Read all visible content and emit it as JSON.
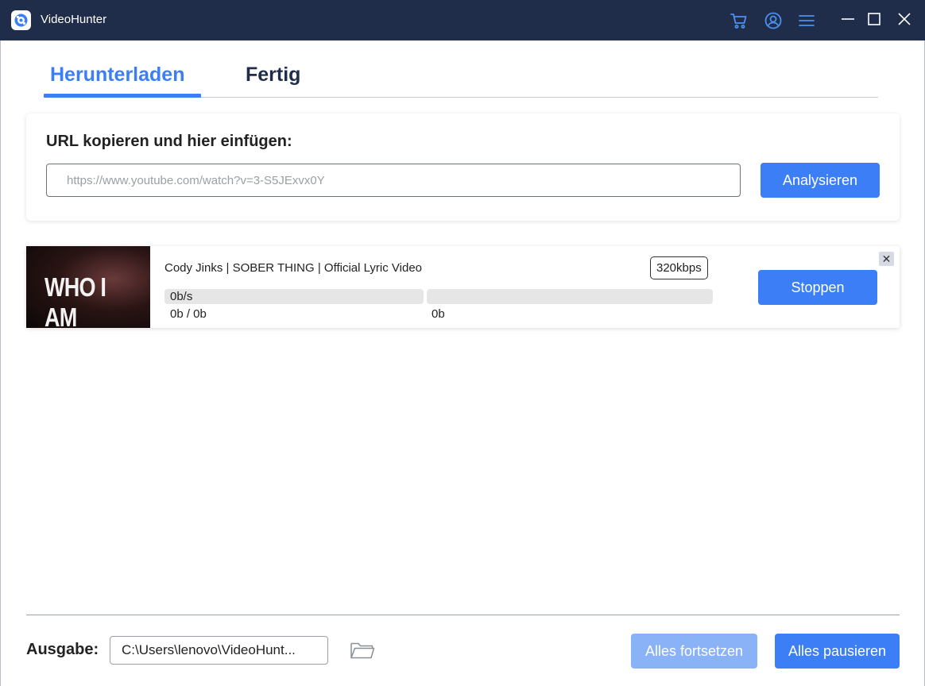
{
  "window": {
    "title": "VideoHunter"
  },
  "tabs": [
    {
      "label": "Herunterladen",
      "active": true
    },
    {
      "label": "Fertig",
      "active": false
    }
  ],
  "url_panel": {
    "heading": "URL kopieren und hier einfügen:",
    "input_placeholder": "https://www.youtube.com/watch?v=3-S5JExvx0Y",
    "input_value": "",
    "analyze_label": "Analysieren"
  },
  "download_item": {
    "thumbnail_text": "WHO I AM",
    "title": "Cody Jinks | SOBER THING | Official Lyric Video",
    "bitrate": "320kbps",
    "speed": "0b/s",
    "progress_size": "0b / 0b",
    "secondary_size": "0b",
    "progress_fraction": 0,
    "stop_label": "Stoppen",
    "close_label": "✕"
  },
  "footer": {
    "output_label": "Ausgabe:",
    "output_path": "C:\\Users\\lenovo\\VideoHunt...",
    "resume_all_label": "Alles fortsetzen",
    "pause_all_label": "Alles pausieren"
  },
  "colors": {
    "titlebar": "#1f2d4a",
    "accent": "#3b7ef6",
    "accent_disabled": "#8ab3f7"
  },
  "icons": [
    "app-logo-icon",
    "cart-icon",
    "account-icon",
    "menu-icon",
    "minimize-icon",
    "maximize-icon",
    "close-icon",
    "folder-icon"
  ]
}
